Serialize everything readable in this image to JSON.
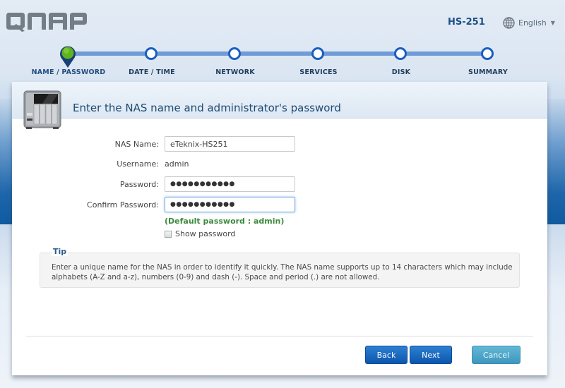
{
  "header": {
    "brand": "QNAP",
    "model": "HS-251",
    "language": "English"
  },
  "wizard": {
    "steps": [
      {
        "label": "NAME / PASSWORD",
        "state": "active"
      },
      {
        "label": "DATE / TIME",
        "state": "pending"
      },
      {
        "label": "NETWORK",
        "state": "pending"
      },
      {
        "label": "SERVICES",
        "state": "pending"
      },
      {
        "label": "DISK",
        "state": "pending"
      },
      {
        "label": "SUMMARY",
        "state": "pending"
      }
    ],
    "current_step": 1,
    "total_steps": 6
  },
  "panel": {
    "title": "Enter the NAS name and administrator's password"
  },
  "form": {
    "nas_name_label": "NAS Name:",
    "nas_name_value": "eTeknix-HS251",
    "username_label": "Username:",
    "username_value": "admin",
    "password_label": "Password:",
    "password_mask": "●●●●●●●●●●●",
    "confirm_label": "Confirm Password:",
    "confirm_mask": "●●●●●●●●●●●",
    "default_hint": "(Default password : admin)",
    "show_password_label": "Show password",
    "show_password_checked": false
  },
  "tip": {
    "title": "Tip",
    "text": "Enter a unique name for the NAS in order to identify it quickly. The NAS name supports up to 14 characters which may include alphabets (A-Z and a-z), numbers (0-9) and dash (-). Space and period (.) are not allowed."
  },
  "buttons": {
    "back": "Back",
    "next": "Next",
    "cancel": "Cancel"
  },
  "colors": {
    "primary_button": "#0c56ad",
    "cancel_button": "#3d97bd",
    "active_step": "#5fb31c",
    "step_track": "#6f9bd8",
    "hint_green": "#3d8a3d"
  }
}
